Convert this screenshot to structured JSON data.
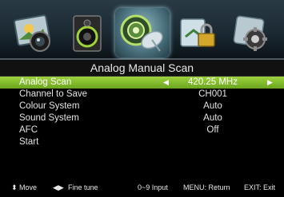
{
  "icons": [
    {
      "name": "picture-icon"
    },
    {
      "name": "sound-icon"
    },
    {
      "name": "channel-satellite-icon"
    },
    {
      "name": "lock-icon"
    },
    {
      "name": "setup-gear-icon"
    }
  ],
  "title": "Analog Manual Scan",
  "rows": [
    {
      "label": "Analog Scan",
      "value": "420.25 MHz",
      "active": true
    },
    {
      "label": "Channel to Save",
      "value": "CH001"
    },
    {
      "label": "Colour System",
      "value": "Auto"
    },
    {
      "label": "Sound System",
      "value": "Auto"
    },
    {
      "label": "AFC",
      "value": "Off"
    },
    {
      "label": "Start",
      "value": ""
    }
  ],
  "footer": {
    "move": "Move",
    "fine_tune": "Fine tune",
    "input": "0~9 Input",
    "return": "MENU: Return",
    "exit": "EXIT: Exit"
  },
  "colors": {
    "highlight": "#8cc63f",
    "background": "#000000",
    "text": "#e4e4e4"
  }
}
